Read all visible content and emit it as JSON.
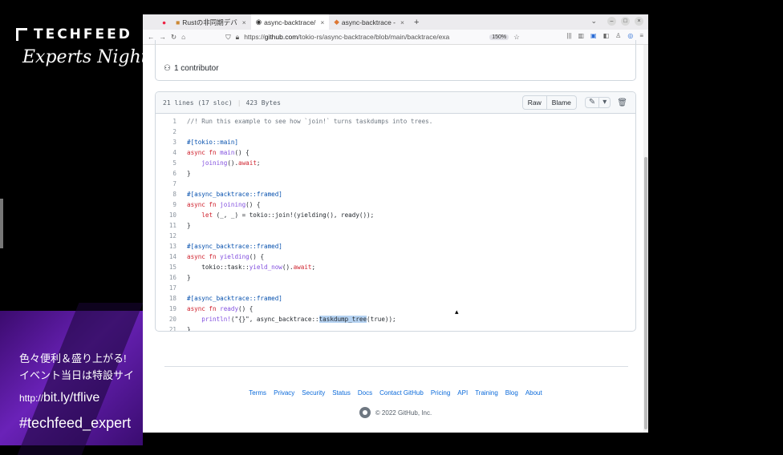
{
  "overlay": {
    "brand": "TECHFEED",
    "brand_sub": "Experts Night",
    "promo_line1": "色々便利＆盛り上がる!",
    "promo_line2": "イベント当日は特設サイ",
    "promo_url_prefix": "http://",
    "promo_url": "bit.ly/tflive",
    "promo_hashtag": "#techfeed_expert"
  },
  "browser": {
    "tabs": [
      {
        "label": "Rustの非同期デバ",
        "active": false
      },
      {
        "label": "async-backtrace/",
        "active": true
      },
      {
        "label": "async-backtrace -",
        "active": false
      }
    ],
    "new_tab": "+",
    "url_prefix": "https://",
    "url_domain": "github.com",
    "url_path": "/tokio-rs/async-backtrace/blob/main/backtrace/exa",
    "zoom": "150%"
  },
  "file": {
    "contributors": "1 contributor",
    "lines_info": "21 lines (17 sloc)",
    "size": "423 Bytes",
    "raw_label": "Raw",
    "blame_label": "Blame"
  },
  "code": [
    {
      "n": "1",
      "parts": [
        {
          "t": "//! Run this example to see how `join!` turns taskdumps into trees.",
          "c": "c-com"
        }
      ]
    },
    {
      "n": "2",
      "parts": []
    },
    {
      "n": "3",
      "parts": [
        {
          "t": "#[tokio::main]",
          "c": "c-attr"
        }
      ]
    },
    {
      "n": "4",
      "parts": [
        {
          "t": "async fn ",
          "c": "c-kw"
        },
        {
          "t": "main",
          "c": "c-fn"
        },
        {
          "t": "() {",
          "c": ""
        }
      ]
    },
    {
      "n": "5",
      "parts": [
        {
          "t": "    ",
          "c": ""
        },
        {
          "t": "joining",
          "c": "c-fn"
        },
        {
          "t": "().",
          "c": ""
        },
        {
          "t": "await",
          "c": "c-kw"
        },
        {
          "t": ";",
          "c": ""
        }
      ]
    },
    {
      "n": "6",
      "parts": [
        {
          "t": "}",
          "c": ""
        }
      ]
    },
    {
      "n": "7",
      "parts": []
    },
    {
      "n": "8",
      "parts": [
        {
          "t": "#[async_backtrace::framed]",
          "c": "c-attr"
        }
      ]
    },
    {
      "n": "9",
      "parts": [
        {
          "t": "async fn ",
          "c": "c-kw"
        },
        {
          "t": "joining",
          "c": "c-fn"
        },
        {
          "t": "() {",
          "c": ""
        }
      ]
    },
    {
      "n": "10",
      "parts": [
        {
          "t": "    ",
          "c": ""
        },
        {
          "t": "let",
          "c": "c-kw"
        },
        {
          "t": " (_, _) = tokio::join!(yielding(), ready());",
          "c": ""
        }
      ]
    },
    {
      "n": "11",
      "parts": [
        {
          "t": "}",
          "c": ""
        }
      ]
    },
    {
      "n": "12",
      "parts": []
    },
    {
      "n": "13",
      "parts": [
        {
          "t": "#[async_backtrace::framed]",
          "c": "c-attr"
        }
      ]
    },
    {
      "n": "14",
      "parts": [
        {
          "t": "async fn ",
          "c": "c-kw"
        },
        {
          "t": "yielding",
          "c": "c-fn"
        },
        {
          "t": "() {",
          "c": ""
        }
      ]
    },
    {
      "n": "15",
      "parts": [
        {
          "t": "    tokio::task::",
          "c": ""
        },
        {
          "t": "yield_now",
          "c": "c-fn"
        },
        {
          "t": "().",
          "c": ""
        },
        {
          "t": "await",
          "c": "c-kw"
        },
        {
          "t": ";",
          "c": ""
        }
      ]
    },
    {
      "n": "16",
      "parts": [
        {
          "t": "}",
          "c": ""
        }
      ]
    },
    {
      "n": "17",
      "parts": []
    },
    {
      "n": "18",
      "parts": [
        {
          "t": "#[async_backtrace::framed]",
          "c": "c-attr"
        }
      ]
    },
    {
      "n": "19",
      "parts": [
        {
          "t": "async fn ",
          "c": "c-kw"
        },
        {
          "t": "ready",
          "c": "c-fn"
        },
        {
          "t": "() {",
          "c": ""
        }
      ]
    },
    {
      "n": "20",
      "parts": [
        {
          "t": "    ",
          "c": ""
        },
        {
          "t": "println!",
          "c": "c-fn"
        },
        {
          "t": "(\"{}\", async_backtrace::",
          "c": ""
        },
        {
          "t": "taskdump_tree",
          "c": "c-hl"
        },
        {
          "t": "(true));",
          "c": ""
        }
      ]
    },
    {
      "n": "21",
      "parts": [
        {
          "t": "}",
          "c": ""
        }
      ]
    }
  ],
  "footer": {
    "links": [
      "Terms",
      "Privacy",
      "Security",
      "Status",
      "Docs",
      "Contact GitHub",
      "Pricing",
      "API",
      "Training",
      "Blog",
      "About"
    ],
    "copyright": "© 2022 GitHub, Inc."
  },
  "colors": {
    "link": "#0969da",
    "keyword": "#cf222e",
    "function": "#8250df",
    "attribute": "#0550ae",
    "highlight": "#b6d3f2"
  }
}
